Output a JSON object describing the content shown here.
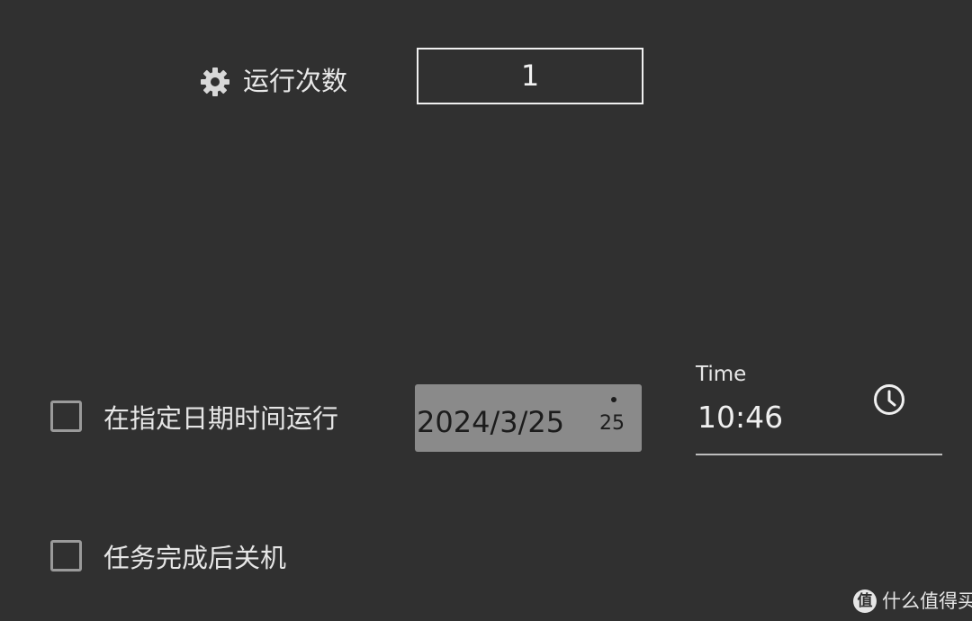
{
  "run_count": {
    "icon": "gear-icon",
    "label": "运行次数",
    "value": "1"
  },
  "schedule": {
    "checkbox_checked": false,
    "label": "在指定日期时间运行",
    "date": {
      "value": "2024/3/25",
      "day_badge": "25"
    },
    "time": {
      "caption": "Time",
      "value": "10:46",
      "icon": "clock-icon"
    }
  },
  "shutdown": {
    "checkbox_checked": false,
    "label": "任务完成后关机"
  },
  "watermark": {
    "badge": "值",
    "text": "什么值得买"
  }
}
